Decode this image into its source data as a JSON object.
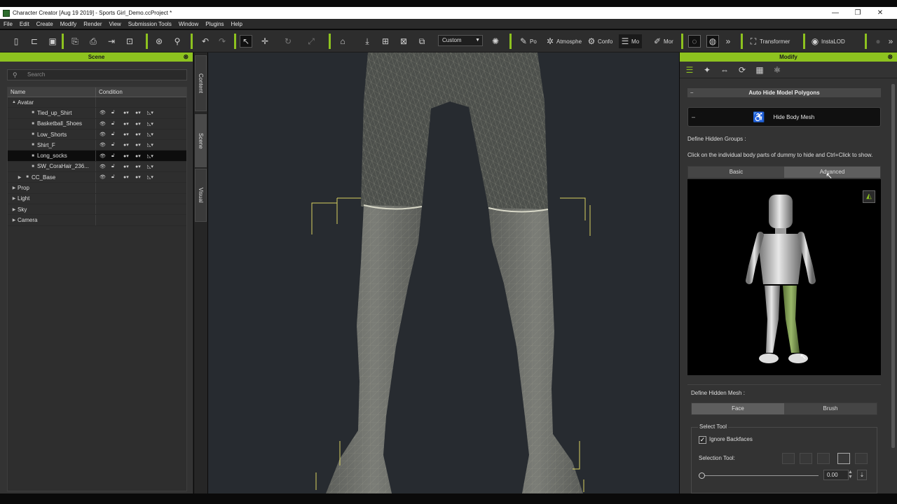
{
  "window": {
    "title": "Character Creator [Aug 19 2019] - Sports Girl_Demo.ccProject *",
    "controls": [
      "—",
      "❐",
      "✕"
    ]
  },
  "menu": [
    "File",
    "Edit",
    "Create",
    "Modify",
    "Render",
    "View",
    "Submission Tools",
    "Window",
    "Plugins",
    "Help"
  ],
  "toolbar": {
    "dropdown_value": "Custom",
    "labels": {
      "pose": "Po",
      "atmosphere": "Atmosphe",
      "conform": "Confo",
      "modify": "Mo",
      "morph": "Mor",
      "transformer": "Transformer",
      "instalod": "InstaLOD"
    },
    "accent_color": "#8dc21f"
  },
  "scene": {
    "title": "Scene",
    "search_placeholder": "Search",
    "columns": {
      "name": "Name",
      "condition": "Condition"
    },
    "tree": [
      {
        "label": "Avatar",
        "indent": 0,
        "expanded": true
      },
      {
        "label": "Tied_up_Shirt",
        "indent": 2
      },
      {
        "label": "Basketball_Shoes",
        "indent": 2
      },
      {
        "label": "Low_Shorts",
        "indent": 2
      },
      {
        "label": "Shirt_F",
        "indent": 2
      },
      {
        "label": "Long_socks",
        "indent": 2,
        "selected": true
      },
      {
        "label": "SW_CoraHair_236...",
        "indent": 2
      },
      {
        "label": "CC_Base",
        "indent": 1,
        "collapsed": true
      },
      {
        "label": "Prop",
        "indent": 0,
        "collapsed": true
      },
      {
        "label": "Light",
        "indent": 0,
        "collapsed": true
      },
      {
        "label": "Sky",
        "indent": 0,
        "collapsed": true
      },
      {
        "label": "Camera",
        "indent": 0,
        "collapsed": true
      }
    ]
  },
  "side_tabs": {
    "content": "Content",
    "scene": "Scene",
    "visual": "Visual"
  },
  "modify": {
    "title": "Modify",
    "section_title": "Auto Hide Model Polygons",
    "hide_body_mesh": "Hide Body Mesh",
    "define_groups": "Define Hidden Groups :",
    "instruction": "Click on the individual body parts of dummy to hide and Ctrl+Click to show.",
    "group_tabs": {
      "basic": "Basic",
      "advanced": "Advanced"
    },
    "define_mesh": "Define Hidden Mesh :",
    "mesh_tabs": {
      "face": "Face",
      "brush": "Brush"
    },
    "select_tool_title": "Select Tool",
    "ignore_backfaces": "Ignore Backfaces",
    "selection_tool_label": "Selection Tool:",
    "slider_value": "0.00",
    "highlight_color": "#7a9a4a"
  }
}
